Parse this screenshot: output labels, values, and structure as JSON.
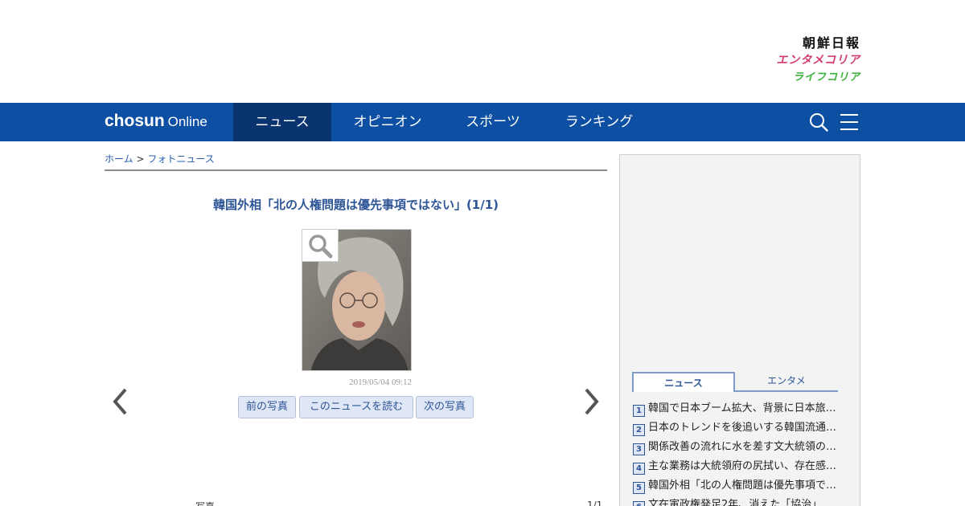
{
  "brands": {
    "chosun": "朝鮮日報",
    "entame": "エンタメコリア",
    "life": "ライフコリア"
  },
  "nav": {
    "logo_main": "chosun",
    "logo_sub": "Online",
    "items": [
      {
        "label": "ニュース",
        "active": true
      },
      {
        "label": "オピニオン"
      },
      {
        "label": "スポーツ"
      },
      {
        "label": "ランキング"
      }
    ],
    "search_icon": "search-icon",
    "menu_icon": "hamburger-menu-icon",
    "bar_color": "#0d4fa3",
    "active_color": "#0a3470"
  },
  "breadcrumb": {
    "home": "ホーム",
    "separator": ">",
    "current": "フォトニュース"
  },
  "article": {
    "title": "韓国外相「北の人権問題は優先事項ではない」(1/1)",
    "timestamp": "2019/05/04 09:12",
    "buttons": {
      "prev": "前の写真",
      "read": "このニュースを読む",
      "next": "次の写真"
    },
    "bottom_left": "写真",
    "bottom_right": "1/1"
  },
  "sidebar": {
    "tabs": [
      {
        "label": "ニュース",
        "active": true
      },
      {
        "label": "エンタメ"
      }
    ],
    "ranking": [
      {
        "rank": "1",
        "title": "韓国で日本ブーム拡大、背景に日本旅行者の増加"
      },
      {
        "rank": "2",
        "title": "日本のトレンドを後追いする韓国流通業界"
      },
      {
        "rank": "3",
        "title": "関係改善の流れに水を差す文大統領の発言"
      },
      {
        "rank": "4",
        "title": "主な業務は大統領府の尻拭い、存在感なき外交部"
      },
      {
        "rank": "5",
        "title": "韓国外相「北の人権問題は優先事項ではない」"
      },
      {
        "rank": "6",
        "title": "文在寅政権発足2年、消えた「協治」"
      }
    ]
  }
}
